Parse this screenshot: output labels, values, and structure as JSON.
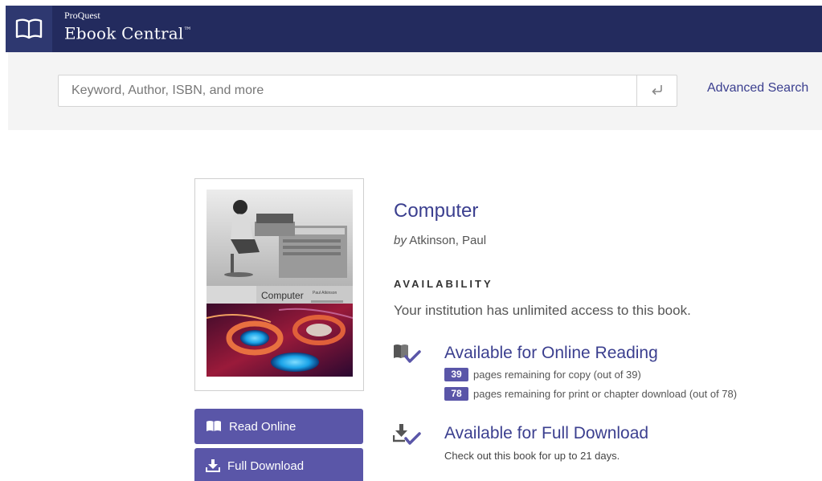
{
  "header": {
    "brand_small": "ProQuest",
    "brand_big": "Ebook Central",
    "trademark": "™",
    "logo_icon": "open-book-icon"
  },
  "search": {
    "placeholder": "Keyword, Author, ISBN, and more",
    "value": "",
    "submit_icon": "enter-arrow-icon",
    "advanced_label": "Advanced Search"
  },
  "book": {
    "cover_title": "Computer",
    "cover_author": "Paul Atkinson",
    "title": "Computer",
    "by_label": "by",
    "author": "Atkinson, Paul"
  },
  "actions": {
    "read_online": "Read Online",
    "full_download": "Full Download"
  },
  "availability": {
    "heading": "AVAILABILITY",
    "access_text": "Your institution has unlimited access to this book.",
    "online": {
      "title": "Available for Online Reading",
      "copy_count": "39",
      "copy_text": "pages remaining for copy (out of 39)",
      "print_count": "78",
      "print_text": "pages remaining for print or chapter download (out of 78)"
    },
    "download": {
      "title": "Available for Full Download",
      "subtitle": "Check out this book for up to 21 days."
    }
  },
  "colors": {
    "header_bg": "#232b5e",
    "accent": "#5a56a8",
    "link": "#3b3f8f"
  }
}
